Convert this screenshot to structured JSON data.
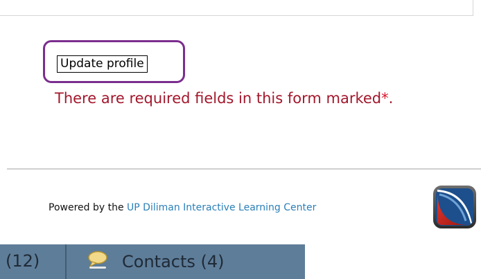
{
  "form": {
    "update_button_label": "Update profile",
    "required_message": "There are required fields in this form marked",
    "required_marker": "*",
    "required_end": "."
  },
  "footer": {
    "powered_by_text": "Powered by the ",
    "powered_by_link": "UP Diliman Interactive Learning Center",
    "logo_icon": "ilc-logo-icon"
  },
  "tabs": {
    "partial_tab_label": "(12)",
    "contacts_icon": "chat-bubble-icon",
    "contacts_label": "Contacts (4)"
  },
  "colors": {
    "highlight": "#7b2d8e",
    "required_text": "#a3172c",
    "link": "#2a7fb8",
    "tabbar": "#5e7d99"
  }
}
